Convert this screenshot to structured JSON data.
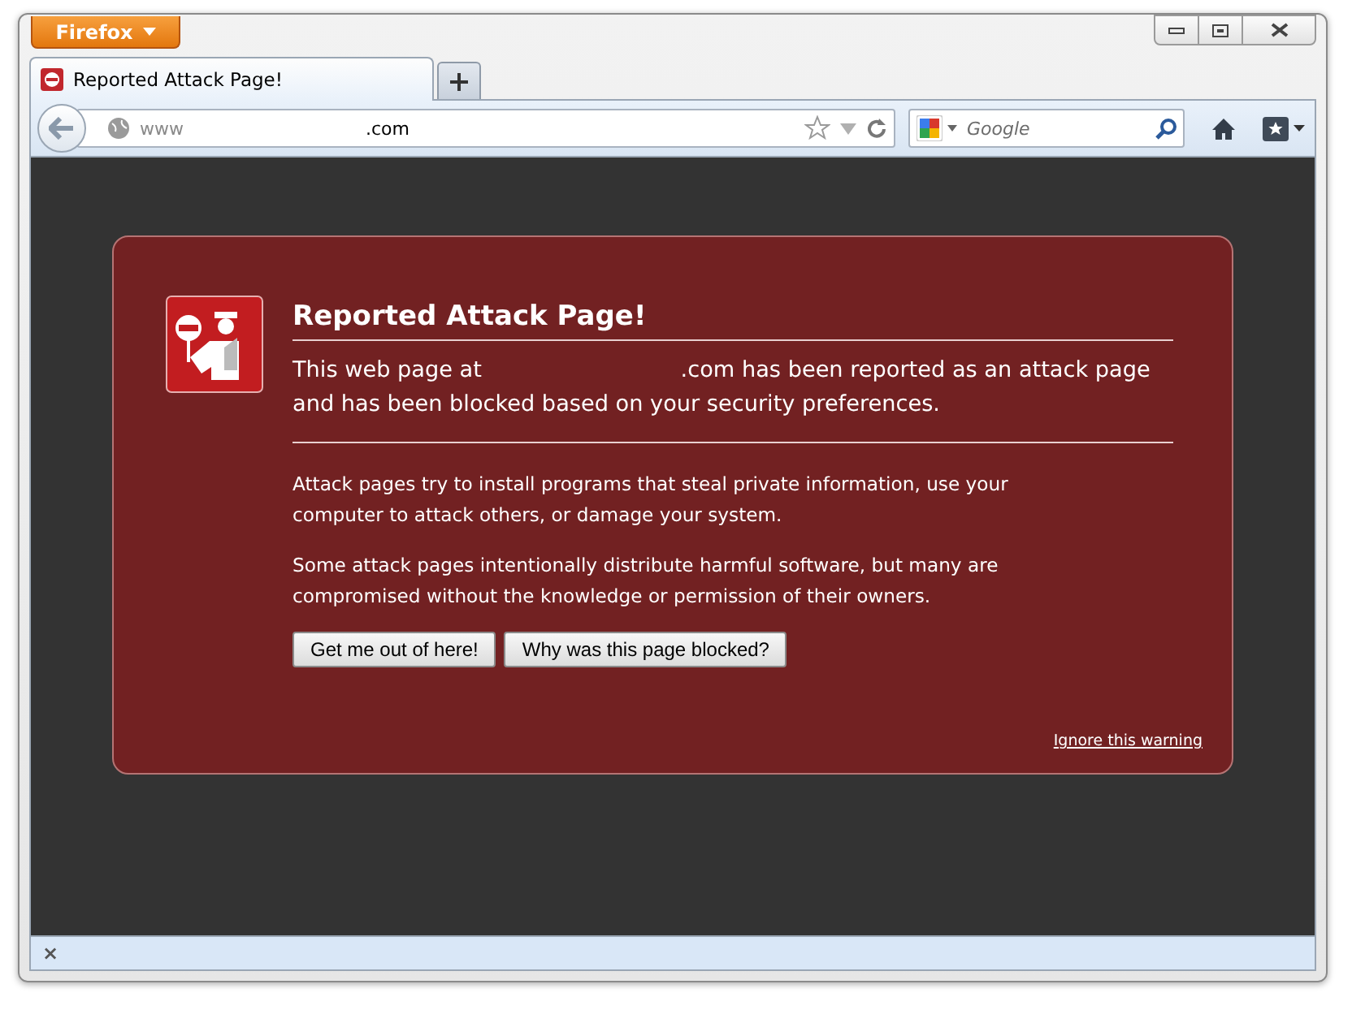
{
  "window": {
    "app_menu": "Firefox"
  },
  "tabs": [
    {
      "title": "Reported Attack Page!",
      "selected": true
    }
  ],
  "address_bar": {
    "url_prefix": "www",
    "url_suffix": ".com"
  },
  "search": {
    "placeholder": "Google"
  },
  "page": {
    "title": "Reported Attack Page!",
    "intro_before": "This web page at",
    "intro_after": ".com has been reported as an attack page and has been blocked based on your security preferences.",
    "paragraphs": [
      "Attack pages try to install programs that steal private information, use your computer to attack others, or damage your system.",
      "Some attack pages intentionally distribute harmful software, but many are compromised without the knowledge or permission of their owners."
    ],
    "buttons": [
      "Get me out of here!",
      "Why was this page blocked?"
    ],
    "ignore_link": "Ignore this warning"
  },
  "status_bar": {
    "close": "×"
  }
}
